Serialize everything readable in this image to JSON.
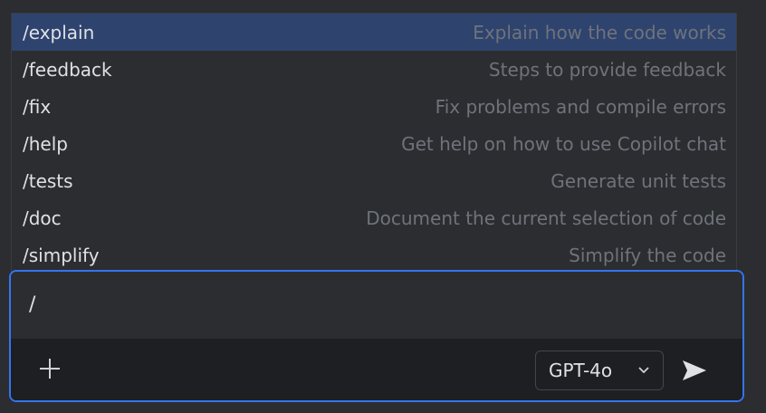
{
  "commands": [
    {
      "name": "/explain",
      "description": "Explain how the code works",
      "selected": true
    },
    {
      "name": "/feedback",
      "description": "Steps to provide feedback",
      "selected": false
    },
    {
      "name": "/fix",
      "description": "Fix problems and compile errors",
      "selected": false
    },
    {
      "name": "/help",
      "description": "Get help on how to use Copilot chat",
      "selected": false
    },
    {
      "name": "/tests",
      "description": "Generate unit tests",
      "selected": false
    },
    {
      "name": "/doc",
      "description": "Document the current selection of code",
      "selected": false
    },
    {
      "name": "/simplify",
      "description": "Simplify the code",
      "selected": false
    }
  ],
  "input": {
    "value": "/"
  },
  "toolbar": {
    "add_icon": "plus-icon",
    "model_label": "GPT-4o",
    "model_icon": "chevron-down-icon",
    "send_icon": "send-icon"
  },
  "colors": {
    "background": "#2b2d30",
    "selection": "#2e436e",
    "focus_border": "#3574f0",
    "text": "#dfe1e5",
    "muted_text": "#6f737a"
  }
}
